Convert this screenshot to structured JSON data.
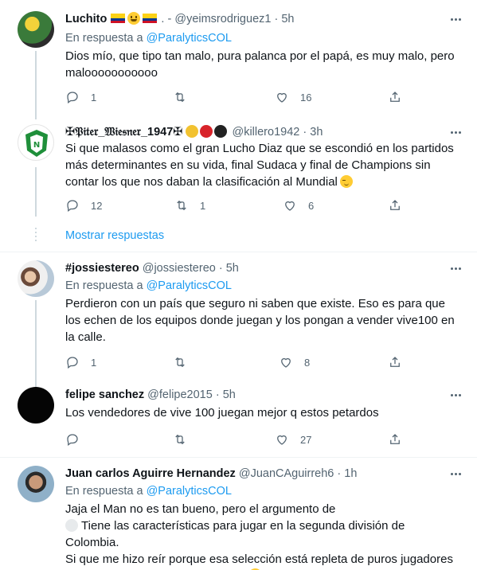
{
  "tweets": [
    {
      "name": "Luchito",
      "handle": "@yeimsrodriguez1",
      "dot": "·",
      "time": "5h",
      "reply_prefix": "En respuesta a",
      "reply_mention": "@ParalyticsCOL",
      "text": "Dios mío, que tipo tan malo, pura palanca por el papá, es muy malo, pero malooooooooooo",
      "replies": "1",
      "retweets": "",
      "likes": "16"
    },
    {
      "name": "✠𝔓𝔦𝔱𝔢𝔯_𝔚𝔦𝔢𝔰𝔫𝔢𝔯_1947✠",
      "handle": "@killero1942",
      "dot": "·",
      "time": "3h",
      "text": "Si que malasos como el gran Lucho Diaz que se escondió en los partidos más determinantes en su vida, final Sudaca y final de Champions sin contar los que nos daban la clasificación al Mundial",
      "replies": "12",
      "retweets": "1",
      "likes": "6"
    },
    {
      "name": "#jossiestereo",
      "handle": "@jossiestereo",
      "dot": "·",
      "time": "5h",
      "reply_prefix": "En respuesta a",
      "reply_mention": "@ParalyticsCOL",
      "text": "Perdieron con un país que seguro ni saben que existe. Eso es para que los echen de los equipos donde juegan y los pongan a vender vive100 en la calle.",
      "replies": "1",
      "retweets": "",
      "likes": "8"
    },
    {
      "name": "felipe sanchez",
      "handle": "@felipe2015",
      "dot": "·",
      "time": "5h",
      "text": "Los vendedores de vive 100 juegan mejor q estos petardos",
      "replies": "",
      "retweets": "",
      "likes": "27"
    },
    {
      "name": "Juan carlos Aguirre Hernandez",
      "handle": "@JuanCAguirreh6",
      "dot": "·",
      "time": "1h",
      "reply_prefix": "En respuesta a",
      "reply_mention": "@ParalyticsCOL",
      "text_line1": "Jaja el Man no es tan bueno, pero el argumento de",
      "text_line2": "Tiene las características para jugar en la segunda división de Colombia.",
      "text_line3": "Si que me hizo reír porque esa selección está repleta de puros jugadores que juegan en la segunda división"
    }
  ],
  "show_replies": "Mostrar respuestas",
  "colors": {
    "accent": "#1d9bf0",
    "muted": "#536471",
    "text": "#0f1419",
    "divider": "#eff3f4"
  }
}
